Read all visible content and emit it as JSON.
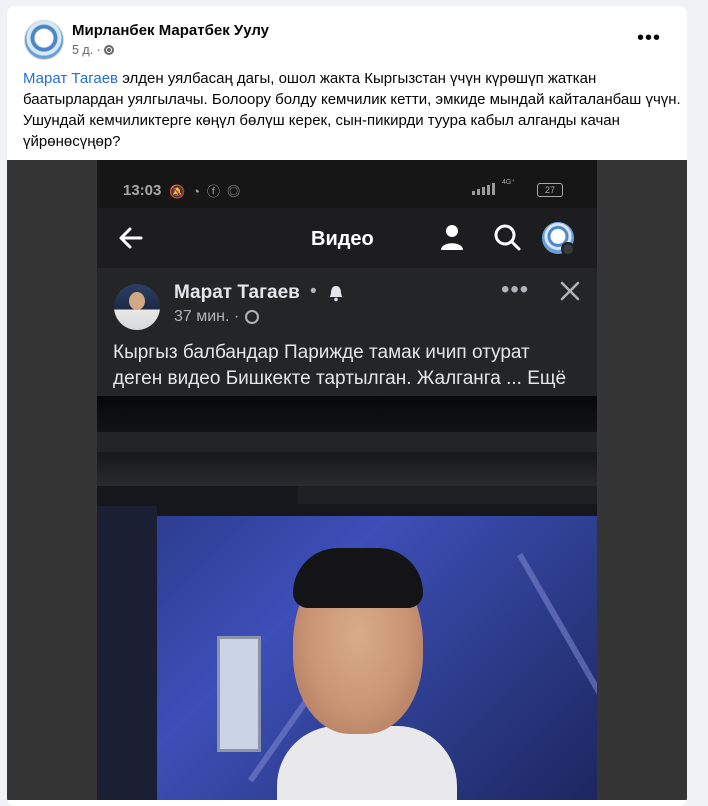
{
  "post": {
    "author": "Мирланбек Маратбек Уулу",
    "time": "5 д. ·",
    "more_label": "•••",
    "text_mention": "Марат Тагаев",
    "text_body": " элден уялбасаң дагы, ошол жакта Кыргызстан үчүн күрөшүп жаткан баатырлардан уялгылачы. Болоору болду кемчилик кетти, эмкиде мындай кайталанбаш үчүн. Ушундай кемчиликтерге көңүл бөлүш керек, сын-пикирди туура кабыл алганды качан үйрөнөсүңөр?"
  },
  "screenshot": {
    "statusbar": {
      "time": "13:03",
      "battery": "27"
    },
    "navbar": {
      "title": "Видео"
    },
    "inner_post": {
      "author": "Марат Тагаев",
      "dot": "•",
      "time": "37 мин. ·",
      "more_label": "•••",
      "text": "Кыргыз балбандар Парижде тамак ичип отурат деген видео Бишкекте тартылган. Жалганга ... Ещё"
    }
  }
}
